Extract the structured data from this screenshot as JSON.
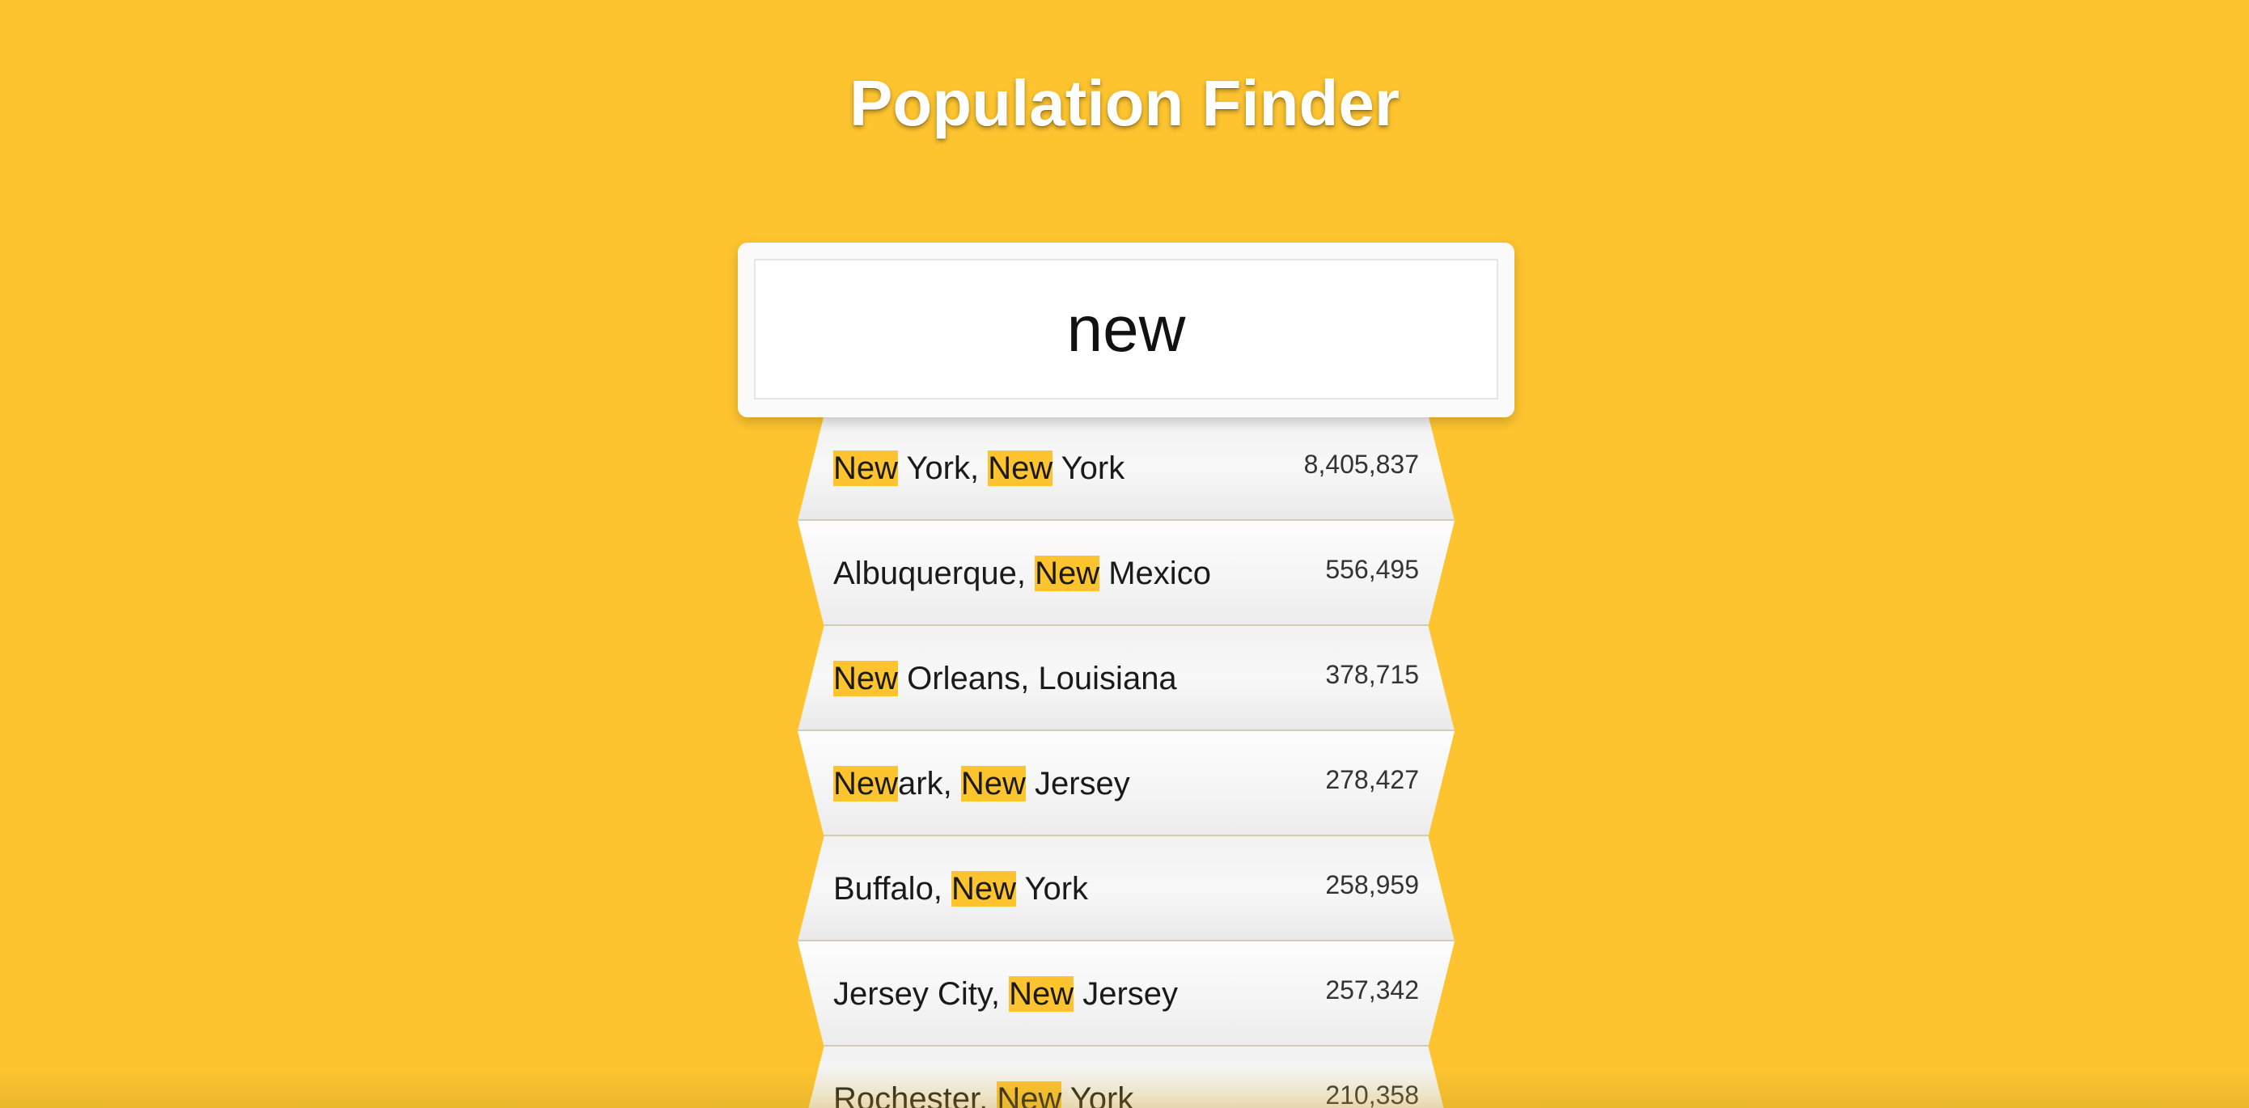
{
  "app": {
    "title": "Population Finder"
  },
  "search": {
    "value": "new"
  },
  "colors": {
    "background": "#fdc42f",
    "highlight": "#fdc42f"
  },
  "results": [
    {
      "parts": [
        {
          "text": "New",
          "hl": true
        },
        {
          "text": " York, ",
          "hl": false
        },
        {
          "text": "New",
          "hl": true
        },
        {
          "text": " York",
          "hl": false
        }
      ],
      "population": "8,405,837"
    },
    {
      "parts": [
        {
          "text": "Albuquerque, ",
          "hl": false
        },
        {
          "text": "New",
          "hl": true
        },
        {
          "text": " Mexico",
          "hl": false
        }
      ],
      "population": "556,495"
    },
    {
      "parts": [
        {
          "text": "New",
          "hl": true
        },
        {
          "text": " Orleans, Louisiana",
          "hl": false
        }
      ],
      "population": "378,715"
    },
    {
      "parts": [
        {
          "text": "New",
          "hl": true
        },
        {
          "text": "ark, ",
          "hl": false
        },
        {
          "text": "New",
          "hl": true
        },
        {
          "text": " Jersey",
          "hl": false
        }
      ],
      "population": "278,427"
    },
    {
      "parts": [
        {
          "text": "Buffalo, ",
          "hl": false
        },
        {
          "text": "New",
          "hl": true
        },
        {
          "text": " York",
          "hl": false
        }
      ],
      "population": "258,959"
    },
    {
      "parts": [
        {
          "text": "Jersey City, ",
          "hl": false
        },
        {
          "text": "New",
          "hl": true
        },
        {
          "text": " Jersey",
          "hl": false
        }
      ],
      "population": "257,342"
    },
    {
      "parts": [
        {
          "text": "Rochester, ",
          "hl": false
        },
        {
          "text": "New",
          "hl": true
        },
        {
          "text": " York",
          "hl": false
        }
      ],
      "population": "210,358"
    }
  ]
}
